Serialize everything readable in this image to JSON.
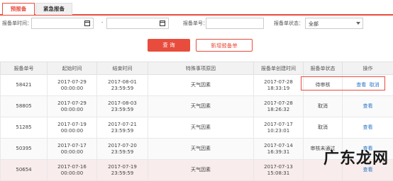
{
  "tabs": [
    "预报备",
    "紧急报备"
  ],
  "filters": {
    "time_label": "报备单时间：",
    "dash": "-",
    "no_label": "报备单号：",
    "status_label": "报备单状态：",
    "status_value": "全部"
  },
  "buttons": {
    "query": "查 询",
    "new": "新增报备单"
  },
  "table": {
    "headers": [
      "报备单号",
      "起始时间",
      "结束时间",
      "特殊事项原因",
      "报备单创建时间",
      "报备单状态",
      "操作"
    ],
    "rows": [
      {
        "id": "58421",
        "start": [
          "2017-07-29",
          "00:00:00"
        ],
        "end": [
          "2017-08-01",
          "23:59:59"
        ],
        "reason": "天气因素",
        "created": [
          "2017-07-28",
          "18:33:19"
        ],
        "status": "待审核",
        "ops": [
          "查看",
          "取消"
        ]
      },
      {
        "id": "58805",
        "start": [
          "2017-07-29",
          "00:00:00"
        ],
        "end": [
          "2017-08-03",
          "23:59:59"
        ],
        "reason": "天气因素",
        "created": [
          "2017-07-28",
          "18:26:32"
        ],
        "status": "取消",
        "ops": [
          "查看"
        ]
      },
      {
        "id": "51285",
        "start": [
          "2017-07-19",
          "00:00:00"
        ],
        "end": [
          "2017-07-21",
          "23:59:59"
        ],
        "reason": "天气因素",
        "created": [
          "2017-07-17",
          "10:23:01"
        ],
        "status": "取消",
        "ops": [
          "查看"
        ]
      },
      {
        "id": "50395",
        "start": [
          "2017-07-17",
          "00:00:00"
        ],
        "end": [
          "2017-07-20",
          "23:59:59"
        ],
        "reason": "天气因素",
        "created": [
          "2017-07-14",
          "16:39:31"
        ],
        "status": "审核未通过",
        "ops": [
          "查看"
        ]
      },
      {
        "id": "50654",
        "start": [
          "2017-07-16",
          "00:00:00"
        ],
        "end": [
          "2017-07-19",
          "23:59:59"
        ],
        "reason": "天气因素",
        "created": [
          "2017-07-13",
          "15:08:31"
        ],
        "status": "",
        "ops": [
          "查看"
        ]
      }
    ]
  },
  "watermark": "广东龙网"
}
